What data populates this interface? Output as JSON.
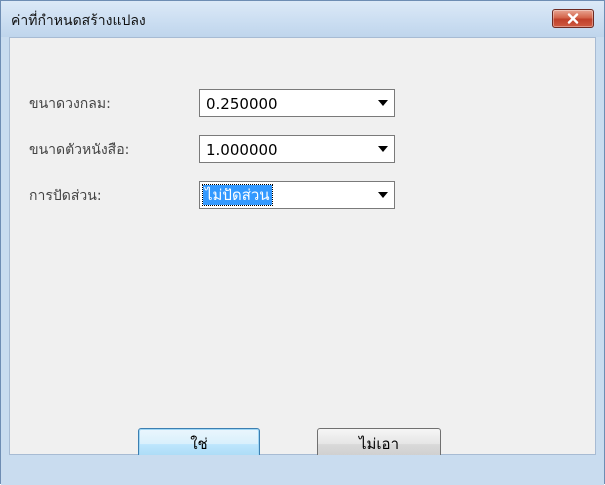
{
  "window": {
    "title": "ค่าที่กำหนดสร้างแปลง"
  },
  "fields": [
    {
      "label": "ขนาดวงกลม:",
      "value": "0.250000"
    },
    {
      "label": "ขนาดตัวหนังสือ:",
      "value": "1.000000"
    },
    {
      "label": "การปัดส่วน:",
      "value": "ไม่ปัดส่วน"
    }
  ],
  "buttons": {
    "ok_label": "ใช่",
    "cancel_label": "ไม่เอา"
  },
  "icons": {
    "close": "close-icon",
    "dropdown": "chevron-down-icon"
  },
  "colors": {
    "titlebar": "#cddff2",
    "close_button": "#c9462c",
    "selection": "#3399ff",
    "client_background": "#f0f0f0"
  }
}
